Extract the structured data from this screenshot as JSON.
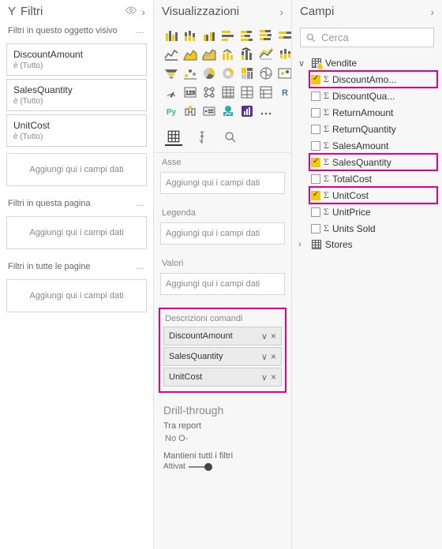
{
  "filters": {
    "title": "Filtri",
    "visual_label": "Filtri in questo oggetto visivo",
    "page_label": "Filtri in questa pagina",
    "all_label": "Filtri in tutte le pagine",
    "add_placeholder": "Aggiungi qui i campi dati",
    "is_all": "è (Tutto)",
    "cards": [
      "DiscountAmount",
      "SalesQuantity",
      "UnitCost"
    ]
  },
  "viz": {
    "title": "Visualizzazioni",
    "axis": "Asse",
    "legend": "Legenda",
    "values": "Valori",
    "tooltips": "Descrizioni comandi",
    "add_placeholder": "Aggiungi qui i campi dati",
    "tooltip_fields": [
      "DiscountAmount",
      "SalesQuantity",
      "UnitCost"
    ],
    "drill": "Drill-through",
    "cross_report": "Tra report",
    "cross_value": "No O-",
    "keep_all": "Mantieni tutti i filtri",
    "keep_toggle": "Attivat"
  },
  "fields": {
    "title": "Campi",
    "search": "Cerca",
    "tables": [
      {
        "name": "Vendite",
        "expanded": true,
        "badge": true,
        "cols": [
          {
            "name": "DiscountAmo...",
            "checked": true,
            "hl": true
          },
          {
            "name": "DiscountQua...",
            "checked": false,
            "hl": false
          },
          {
            "name": "ReturnAmount",
            "checked": false,
            "hl": false
          },
          {
            "name": "ReturnQuantity",
            "checked": false,
            "hl": false
          },
          {
            "name": "SalesAmount",
            "checked": false,
            "hl": false
          },
          {
            "name": "SalesQuantity",
            "checked": true,
            "hl": true
          },
          {
            "name": "TotalCost",
            "checked": false,
            "hl": false
          },
          {
            "name": "UnitCost",
            "checked": true,
            "hl": true
          },
          {
            "name": "UnitPrice",
            "checked": false,
            "hl": false
          },
          {
            "name": "Units Sold",
            "checked": false,
            "hl": false
          }
        ]
      },
      {
        "name": "Stores",
        "expanded": false,
        "badge": false,
        "cols": []
      }
    ]
  }
}
